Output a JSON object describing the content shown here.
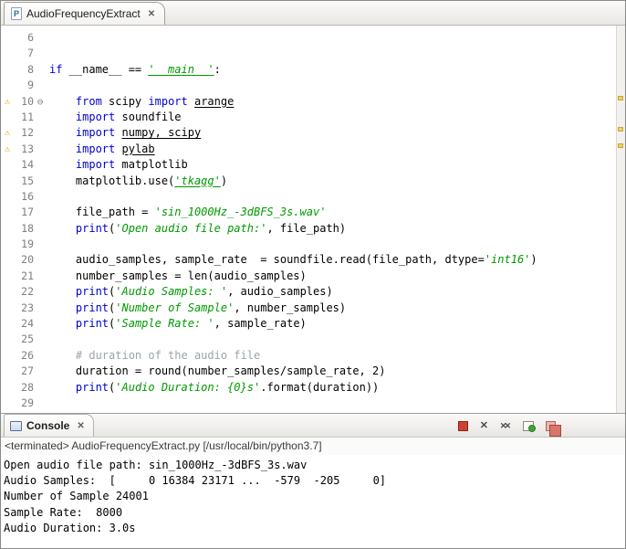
{
  "palette": {
    "keyword_blue": "#0000d0",
    "string_green": "#009900",
    "comment_gray": "#9aa4ab",
    "warning_yellow": "#e0a712",
    "terminate_red": "#cd4033"
  },
  "editor": {
    "tab": {
      "label": "AudioFrequencyExtract",
      "icon_letter": "P",
      "close_glyph": "✕"
    },
    "gutter": {
      "warning_glyph": "⚠",
      "fold_glyph": "⊖"
    },
    "lines": [
      {
        "n": 6,
        "tokens": []
      },
      {
        "n": 7,
        "tokens": []
      },
      {
        "n": 8,
        "tokens": [
          [
            "k",
            "if"
          ],
          [
            "p",
            " __name__ == "
          ],
          [
            "su",
            "'__main__'"
          ],
          [
            "p",
            ":"
          ]
        ]
      },
      {
        "n": 9,
        "tokens": []
      },
      {
        "n": 10,
        "warn": true,
        "fold": true,
        "tokens": [
          [
            "p",
            "    "
          ],
          [
            "k",
            "from"
          ],
          [
            "p",
            " scipy "
          ],
          [
            "k",
            "import"
          ],
          [
            "p",
            " "
          ],
          [
            "pu",
            "arange"
          ]
        ]
      },
      {
        "n": 11,
        "tokens": [
          [
            "p",
            "    "
          ],
          [
            "k",
            "import"
          ],
          [
            "p",
            " soundfile"
          ]
        ]
      },
      {
        "n": 12,
        "warn": true,
        "tokens": [
          [
            "p",
            "    "
          ],
          [
            "k",
            "import"
          ],
          [
            "p",
            " "
          ],
          [
            "pu",
            "numpy, scipy"
          ]
        ]
      },
      {
        "n": 13,
        "warn": true,
        "tokens": [
          [
            "p",
            "    "
          ],
          [
            "k",
            "import"
          ],
          [
            "p",
            " "
          ],
          [
            "pu",
            "pylab"
          ]
        ]
      },
      {
        "n": 14,
        "tokens": [
          [
            "p",
            "    "
          ],
          [
            "k",
            "import"
          ],
          [
            "p",
            " matplotlib"
          ]
        ]
      },
      {
        "n": 15,
        "tokens": [
          [
            "p",
            "    matplotlib.use("
          ],
          [
            "su",
            "'tkagg'"
          ],
          [
            "p",
            ")"
          ]
        ]
      },
      {
        "n": 16,
        "tokens": []
      },
      {
        "n": 17,
        "tokens": [
          [
            "p",
            "    file_path = "
          ],
          [
            "s",
            "'sin_1000Hz_-3dBFS_3s.wav'"
          ]
        ]
      },
      {
        "n": 18,
        "tokens": [
          [
            "p",
            "    "
          ],
          [
            "k",
            "print"
          ],
          [
            "p",
            "("
          ],
          [
            "s",
            "'Open audio file path:'"
          ],
          [
            "p",
            ", file_path)"
          ]
        ]
      },
      {
        "n": 19,
        "tokens": []
      },
      {
        "n": 20,
        "tokens": [
          [
            "p",
            "    audio_samples, sample_rate  = soundfile.read(file_path, dtype="
          ],
          [
            "s",
            "'int16'"
          ],
          [
            "p",
            ")"
          ]
        ]
      },
      {
        "n": 21,
        "tokens": [
          [
            "p",
            "    number_samples = len(audio_samples)"
          ]
        ]
      },
      {
        "n": 22,
        "tokens": [
          [
            "p",
            "    "
          ],
          [
            "k",
            "print"
          ],
          [
            "p",
            "("
          ],
          [
            "s",
            "'Audio Samples: '"
          ],
          [
            "p",
            ", audio_samples)"
          ]
        ]
      },
      {
        "n": 23,
        "tokens": [
          [
            "p",
            "    "
          ],
          [
            "k",
            "print"
          ],
          [
            "p",
            "("
          ],
          [
            "s",
            "'Number of Sample'"
          ],
          [
            "p",
            ", number_samples)"
          ]
        ]
      },
      {
        "n": 24,
        "tokens": [
          [
            "p",
            "    "
          ],
          [
            "k",
            "print"
          ],
          [
            "p",
            "("
          ],
          [
            "s",
            "'Sample Rate: '"
          ],
          [
            "p",
            ", sample_rate)"
          ]
        ]
      },
      {
        "n": 25,
        "tokens": []
      },
      {
        "n": 26,
        "tokens": [
          [
            "p",
            "    "
          ],
          [
            "c",
            "# duration of the audio file"
          ]
        ]
      },
      {
        "n": 27,
        "tokens": [
          [
            "p",
            "    duration = round(number_samples/sample_rate, 2)"
          ]
        ]
      },
      {
        "n": 28,
        "tokens": [
          [
            "p",
            "    "
          ],
          [
            "k",
            "print"
          ],
          [
            "p",
            "("
          ],
          [
            "s",
            "'Audio Duration: {0}s'"
          ],
          [
            "p",
            ".format(duration))"
          ]
        ]
      },
      {
        "n": 29,
        "tokens": []
      }
    ]
  },
  "console": {
    "tab": {
      "label": "Console",
      "close_glyph": "✕"
    },
    "toolbar": [
      {
        "id": "terminate",
        "name": "terminate-button",
        "glyph": ""
      },
      {
        "id": "remove-launch",
        "name": "remove-launch-button",
        "glyph": "✕"
      },
      {
        "id": "remove-all",
        "name": "remove-all-terminated-button",
        "glyph": "✕✕"
      },
      {
        "id": "open-console",
        "name": "open-console-button",
        "glyph": ""
      },
      {
        "id": "pin-console",
        "name": "pin-console-button",
        "glyph": ""
      }
    ],
    "status_line": "<terminated> AudioFrequencyExtract.py [/usr/local/bin/python3.7]",
    "output": [
      "Open audio file path: sin_1000Hz_-3dBFS_3s.wav",
      "Audio Samples:  [     0 16384 23171 ...  -579  -205     0]",
      "Number of Sample 24001",
      "Sample Rate:  8000",
      "Audio Duration: 3.0s"
    ]
  }
}
